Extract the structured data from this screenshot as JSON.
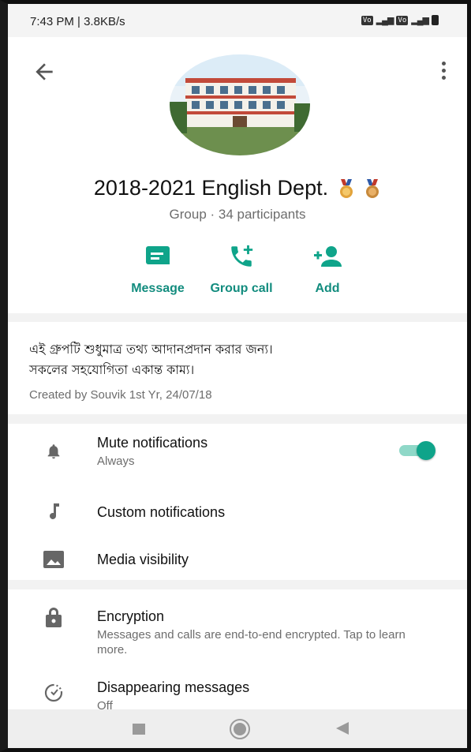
{
  "status_bar": {
    "time": "7:43 PM | 3.8KB/s"
  },
  "group": {
    "name": "2018-2021 English Dept.",
    "subtitle": "Group · 34 participants"
  },
  "actions": [
    {
      "label": "Message",
      "icon": "message-icon"
    },
    {
      "label": "Group call",
      "icon": "add-call-icon"
    },
    {
      "label": "Add",
      "icon": "add-person-icon"
    }
  ],
  "description": {
    "line1": "এই গ্রুপটি শুধুমাত্র তথ্য আদানপ্রদান করার জন্য।",
    "line2": "সকলের সহযোগিতা একান্ত কাম্য।",
    "created": "Created by Souvik 1st Yr, 24/07/18"
  },
  "settings": {
    "mute": {
      "title": "Mute notifications",
      "subtitle": "Always",
      "enabled": true
    },
    "custom": {
      "title": "Custom notifications"
    },
    "media": {
      "title": "Media visibility"
    }
  },
  "security": {
    "encryption": {
      "title": "Encryption",
      "subtitle": "Messages and calls are end-to-end encrypted. Tap to learn more."
    },
    "disappearing": {
      "title": "Disappearing messages",
      "subtitle": "Off"
    }
  },
  "colors": {
    "accent": "#128c7e",
    "toggle_on": "#0fa48a"
  }
}
